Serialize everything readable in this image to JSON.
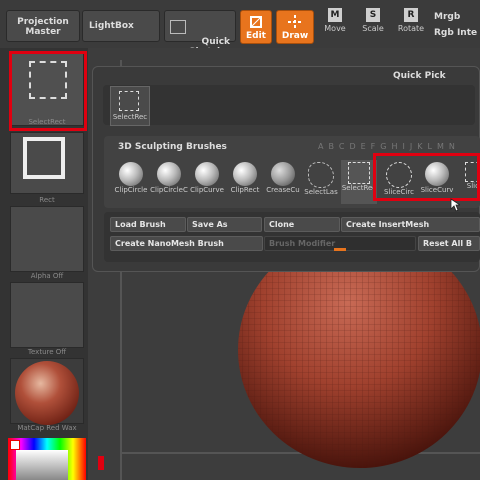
{
  "toolbar": {
    "projection_master": "Projection\nMaster",
    "lightbox": "LightBox",
    "quick_sketch": "Quick\nSketch",
    "edit": "Edit",
    "draw": "Draw",
    "move": "Move",
    "scale": "Scale",
    "rotate": "Rotate",
    "mrgb": "Mrgb",
    "rgb_intensity": "Rgb Inte"
  },
  "shelf": {
    "selectrect": "SelectRect",
    "rect": "Rect",
    "alpha": "Alpha Off",
    "texture": "Texture Off",
    "material": "MatCap Red Wax"
  },
  "panel": {
    "title": "Quick Pick",
    "recent_brush": "SelectRec",
    "section": "3D Sculpting Brushes",
    "letters": [
      "A",
      "B",
      "C",
      "D",
      "E",
      "F",
      "G",
      "H",
      "I",
      "J",
      "K",
      "L",
      "M",
      "N"
    ],
    "brushes": [
      "ClipCircle",
      "ClipCircleC",
      "ClipCurve",
      "ClipRect",
      "CreaseCu",
      "SelectLas",
      "SelectRec",
      "SliceCirc",
      "SliceCurv",
      "Slice"
    ],
    "buttons": {
      "load": "Load Brush",
      "save": "Save As",
      "clone": "Clone",
      "insert": "Create InsertMesh",
      "nanomesh": "Create NanoMesh Brush",
      "modifier": "Brush Modifier",
      "reset": "Reset All B"
    }
  },
  "colors": {
    "accent_orange": "#e8741d",
    "highlight_red": "#e00010",
    "mesh_red": "#a0412e"
  }
}
